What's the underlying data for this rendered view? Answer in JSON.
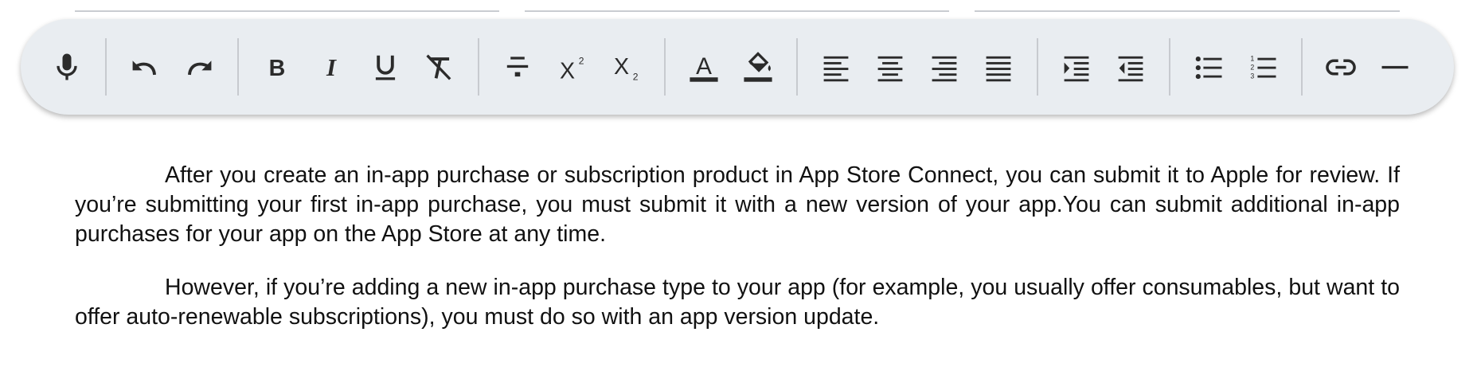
{
  "toolbar": {
    "groups": [
      [
        {
          "name": "microphone-icon",
          "label": "Voice input"
        }
      ],
      [
        {
          "name": "undo-icon",
          "label": "Undo"
        },
        {
          "name": "redo-icon",
          "label": "Redo"
        }
      ],
      [
        {
          "name": "bold-icon",
          "label": "Bold"
        },
        {
          "name": "italic-icon",
          "label": "Italic"
        },
        {
          "name": "underline-icon",
          "label": "Underline"
        },
        {
          "name": "clear-formatting-icon",
          "label": "Clear formatting"
        }
      ],
      [
        {
          "name": "strikethrough-icon",
          "label": "Strikethrough"
        },
        {
          "name": "superscript-icon",
          "label": "Superscript"
        },
        {
          "name": "subscript-icon",
          "label": "Subscript"
        }
      ],
      [
        {
          "name": "text-color-icon",
          "label": "Text color"
        },
        {
          "name": "highlight-color-icon",
          "label": "Highlight color"
        }
      ],
      [
        {
          "name": "align-left-icon",
          "label": "Align left"
        },
        {
          "name": "align-center-icon",
          "label": "Align center"
        },
        {
          "name": "align-right-icon",
          "label": "Align right"
        },
        {
          "name": "align-justify-icon",
          "label": "Justify"
        }
      ],
      [
        {
          "name": "indent-increase-icon",
          "label": "Increase indent"
        },
        {
          "name": "indent-decrease-icon",
          "label": "Decrease indent"
        }
      ],
      [
        {
          "name": "bulleted-list-icon",
          "label": "Bulleted list"
        },
        {
          "name": "numbered-list-icon",
          "label": "Numbered list"
        }
      ],
      [
        {
          "name": "link-icon",
          "label": "Insert link"
        },
        {
          "name": "horizontal-rule-icon",
          "label": "Horizontal line"
        }
      ]
    ],
    "colors": {
      "background": "#e9edf1",
      "icon": "#2b2b2b",
      "separator": "#c7cacf"
    }
  },
  "document": {
    "paragraphs": [
      "After you create an in-app purchase or subscription product in App Store Connect, you can submit it to Apple for review. If you’re submitting your first in-app purchase, you must submit it with a new version of your app.You can submit additional in-app purchases for your app on the App Store at any time.",
      "However, if you’re adding a new in-app purchase type to your app (for example, you usually offer consumables, but want to offer auto-renewable subscriptions), you must do so with an app version update."
    ]
  }
}
